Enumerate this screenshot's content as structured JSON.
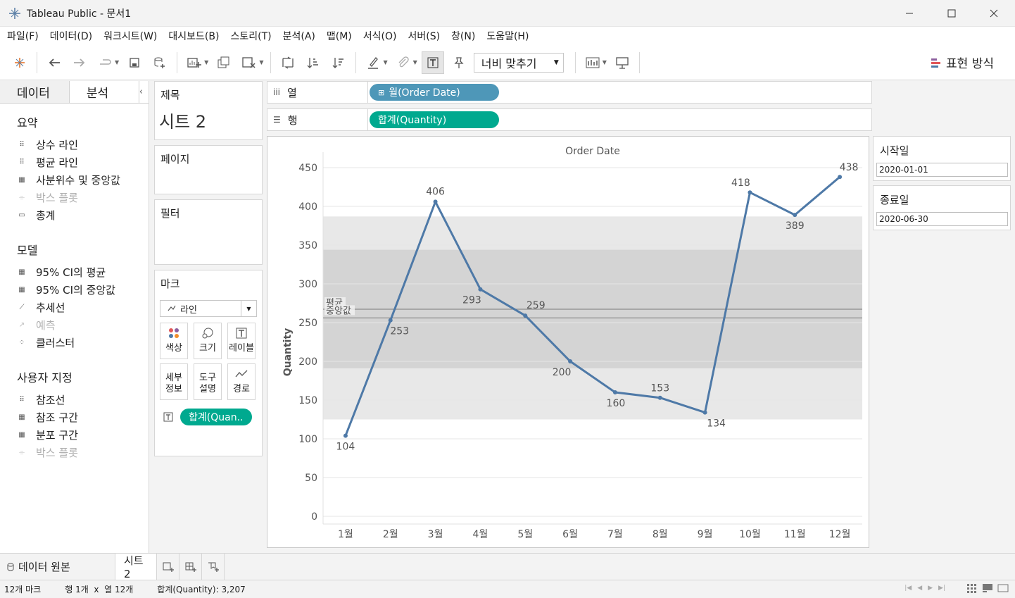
{
  "window": {
    "title": "Tableau Public - 문서1"
  },
  "menu": [
    "파일(F)",
    "데이터(D)",
    "워크시트(W)",
    "대시보드(B)",
    "스토리(T)",
    "분석(A)",
    "맵(M)",
    "서식(O)",
    "서버(S)",
    "창(N)",
    "도움말(H)"
  ],
  "toolbar": {
    "fit_label": "너비 맞추기",
    "show_me_label": "표현 방식"
  },
  "left_pane": {
    "tabs": [
      "데이터",
      "분석"
    ],
    "sections": [
      {
        "title": "요약",
        "items": [
          {
            "label": "상수 라인",
            "icon": "constant-line-icon",
            "dim": false
          },
          {
            "label": "평균 라인",
            "icon": "average-line-icon",
            "dim": false
          },
          {
            "label": "사분위수 및 중앙값",
            "icon": "quartile-icon",
            "dim": false
          },
          {
            "label": "박스 플롯",
            "icon": "box-plot-icon",
            "dim": true
          },
          {
            "label": "총계",
            "icon": "totals-icon",
            "dim": false
          }
        ]
      },
      {
        "title": "모델",
        "items": [
          {
            "label": "95% CI의 평균",
            "icon": "ci-mean-icon",
            "dim": false
          },
          {
            "label": "95% CI의 중앙값",
            "icon": "ci-median-icon",
            "dim": false
          },
          {
            "label": "추세선",
            "icon": "trend-line-icon",
            "dim": false
          },
          {
            "label": "예측",
            "icon": "forecast-icon",
            "dim": true
          },
          {
            "label": "클러스터",
            "icon": "cluster-icon",
            "dim": false
          }
        ]
      },
      {
        "title": "사용자 지정",
        "items": [
          {
            "label": "참조선",
            "icon": "reference-line-icon",
            "dim": false
          },
          {
            "label": "참조 구간",
            "icon": "reference-band-icon",
            "dim": false
          },
          {
            "label": "분포 구간",
            "icon": "distribution-band-icon",
            "dim": false
          },
          {
            "label": "박스 플롯",
            "icon": "box-plot-icon",
            "dim": true
          }
        ]
      }
    ]
  },
  "cards": {
    "title_label": "제목",
    "sheet_title": "시트 2",
    "pages_label": "페이지",
    "filters_label": "필터",
    "marks_label": "마크",
    "mark_type": "라인",
    "mark_buttons": [
      "색상",
      "크기",
      "레이블",
      "세부\n정보",
      "도구\n설명",
      "경로"
    ],
    "mark_pill": "합계(Quan.."
  },
  "shelves": {
    "columns_label": "열",
    "columns_pill": "월(Order Date)",
    "rows_label": "행",
    "rows_pill": "합계(Quantity)"
  },
  "parameters": {
    "start_label": "시작일",
    "start_value": "2020-01-01",
    "end_label": "종료일",
    "end_value": "2020-06-30"
  },
  "chart_data": {
    "type": "line",
    "title": "Order Date",
    "ylabel": "Quantity",
    "xlabel": "",
    "categories": [
      "1월",
      "2월",
      "3월",
      "4월",
      "5월",
      "6월",
      "7월",
      "8월",
      "9월",
      "10월",
      "11월",
      "12월"
    ],
    "values": [
      104,
      253,
      406,
      293,
      259,
      200,
      160,
      153,
      134,
      418,
      389,
      438
    ],
    "ylim": [
      0,
      450
    ],
    "yticks": [
      0,
      50,
      100,
      150,
      200,
      250,
      300,
      350,
      400,
      450
    ],
    "reference_lines": [
      {
        "label": "평균",
        "value": 267.25
      },
      {
        "label": "중앙값",
        "value": 256
      }
    ],
    "bands": {
      "outer": [
        125,
        387
      ],
      "inner": [
        191,
        344
      ]
    },
    "line_color": "#4e79a7",
    "grid": true
  },
  "bottom_tabs": {
    "data_source": "데이터 원본",
    "sheet": "시트 2"
  },
  "status": {
    "marks": "12개 마크",
    "rows_cols": "행 1개  x  열 12개",
    "sum": "합계(Quantity): 3,207"
  }
}
